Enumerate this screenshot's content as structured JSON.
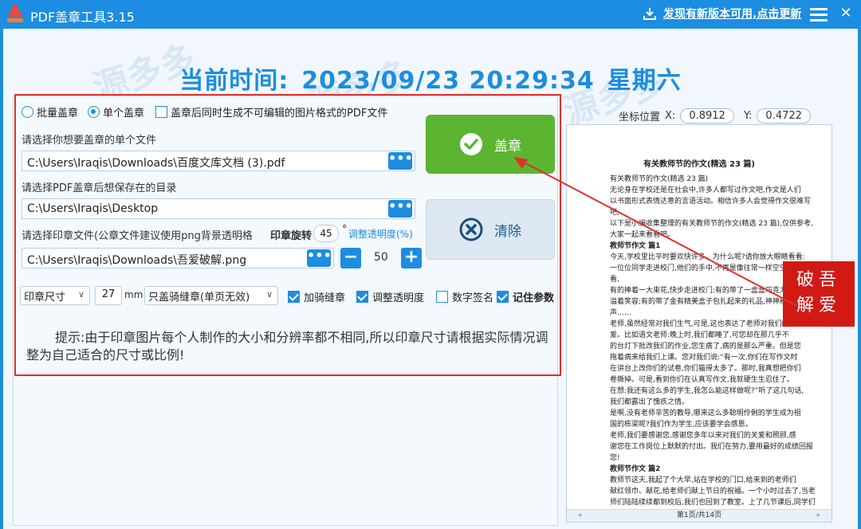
{
  "app": {
    "title": "PDF盖章工具3.15",
    "update_text": "发现有新版本可用,点击更新"
  },
  "clock": {
    "label": "当前时间:",
    "datetime": "2023/09/23 20:29:34",
    "weekday": "星期六"
  },
  "mode": {
    "batch_label": "批量盖章",
    "single_label": "单个盖章",
    "selected": "单个盖章",
    "image_pdf_label": "盖章后同时生成不可编辑的图片格式的PDF文件",
    "image_pdf_checked": false
  },
  "file": {
    "prompt": "请选择你想要盖章的单个文件",
    "value": "C:\\Users\\Iraqis\\Downloads\\百度文库文档 (3).pdf",
    "browse": "•••"
  },
  "output": {
    "prompt": "请选择PDF盖章后想保存在的目录",
    "value": "C:\\Users\\Iraqis\\Desktop",
    "browse": "•••"
  },
  "stamp": {
    "prompt": "请选择印章文件(公章文件建议使用png背景透明格",
    "rotate_label": "印章旋转",
    "rotate_value": "45",
    "degree": "°",
    "opacity_link": "调整透明度(%)",
    "value": "C:\\Users\\Iraqis\\Downloads\\吾爱破解.png",
    "browse": "•••",
    "minus": "−",
    "opacity_value": "50",
    "plus": "+"
  },
  "options": {
    "size_select": "印章尺寸",
    "size_value": "27",
    "size_unit": "mm",
    "seam_select": "只盖骑缝章(单页无效)",
    "seam_label": "加骑缝章",
    "seam_checked": true,
    "opacity_label": "调整透明度",
    "opacity_checked": true,
    "digital_label": "数字签名",
    "digital_checked": false,
    "remember_label": "记住参数",
    "remember_checked": true
  },
  "tip": "提示:由于印章图片每个人制作的大小和分辨率都不相同,所以印章尺寸请根据实际情况调整为自己适合的尺寸或比例!",
  "buttons": {
    "stamp": "盖章",
    "clear": "清除"
  },
  "coords": {
    "label": "坐标位置",
    "x_label": "X:",
    "x_value": "0.8912",
    "y_label": "Y:",
    "y_value": "0.4722"
  },
  "preview": {
    "title": "有关教师节的作文(精选 23 篇)",
    "lines": [
      "有关教师节的作文(精选 23 篇)",
      "无论身在学校还是在社会中,许多人都写过作文吧,作文是人们",
      "以书面形式表情达意的言语活动。相信许多人会觉得作文很难写吧,",
      "以下是小编收集整理的有关教师节的作文(精选 23 篇),仅供参考,",
      "大家一起来看看吧。",
      "教师节作文 篇1",
      "今天,学校里比平时要欢快许多。为什么呢?请你放大眼睛看看:",
      "一位位同学走进校门,他们的手中,不再是像往常一样空空如也。看,",
      "有的捧着一大束花,快步走进校门;有的带了一盒盒巧克力,脸上洋",
      "溢着笑容;有的带了金有精美盒子包扎起来的礼品,神神秘秘地笑一",
      "声……",
      "老师,虽然经常对我们生气,可是,这也表达了老师对我们的",
      "爱。比如语文老师:晚上时,我们都睡了,可您却在那几乎不",
      "的台灯下批改我们的作业,您生病了,病的是那么严重。但是您",
      "拖着病来给我们上课。您对我们说:“有一次,你们在写作文时",
      "在讲台上改你们的试卷,你们猫得太多了。那时,我真想把你们",
      "卷撕掉。可是,看到你们在认真写作文,我就硬生生忍住了。",
      "在想:我还有这么多的学生,我怎么能这样做呢?”听了这几句话,",
      "我们都露出了愧疚之情。",
      "是啊,没有老师辛苦的教导,哪来这么多聪明伶俐的学生成为祖",
      "国的栋梁呢?我们作为学生,应该要学会感恩。",
      "老师,我们要感谢您,感谢您多年以来对我们的关爱和照顾,感",
      "谢您在工作岗位上默默的付出。我们在努力,要用最好的成绩回报您!",
      "教师节作文 篇2",
      "教师节这天,我起了个大早,站在学校的门口,给来到的老师们",
      "献红领巾、献花,给老师们献上节日的祝福。一个小时过去了,当老",
      "师们陆陆续续都到校后,我们也回到了教室。上了几节课后,同学们",
      "说:“今天是教师节,我们也没给林老师准备什么礼物,不如我们今"
    ],
    "pager": "第1页/共14页",
    "prev": "«",
    "next": "»"
  },
  "seal_text": "破吾解爱"
}
